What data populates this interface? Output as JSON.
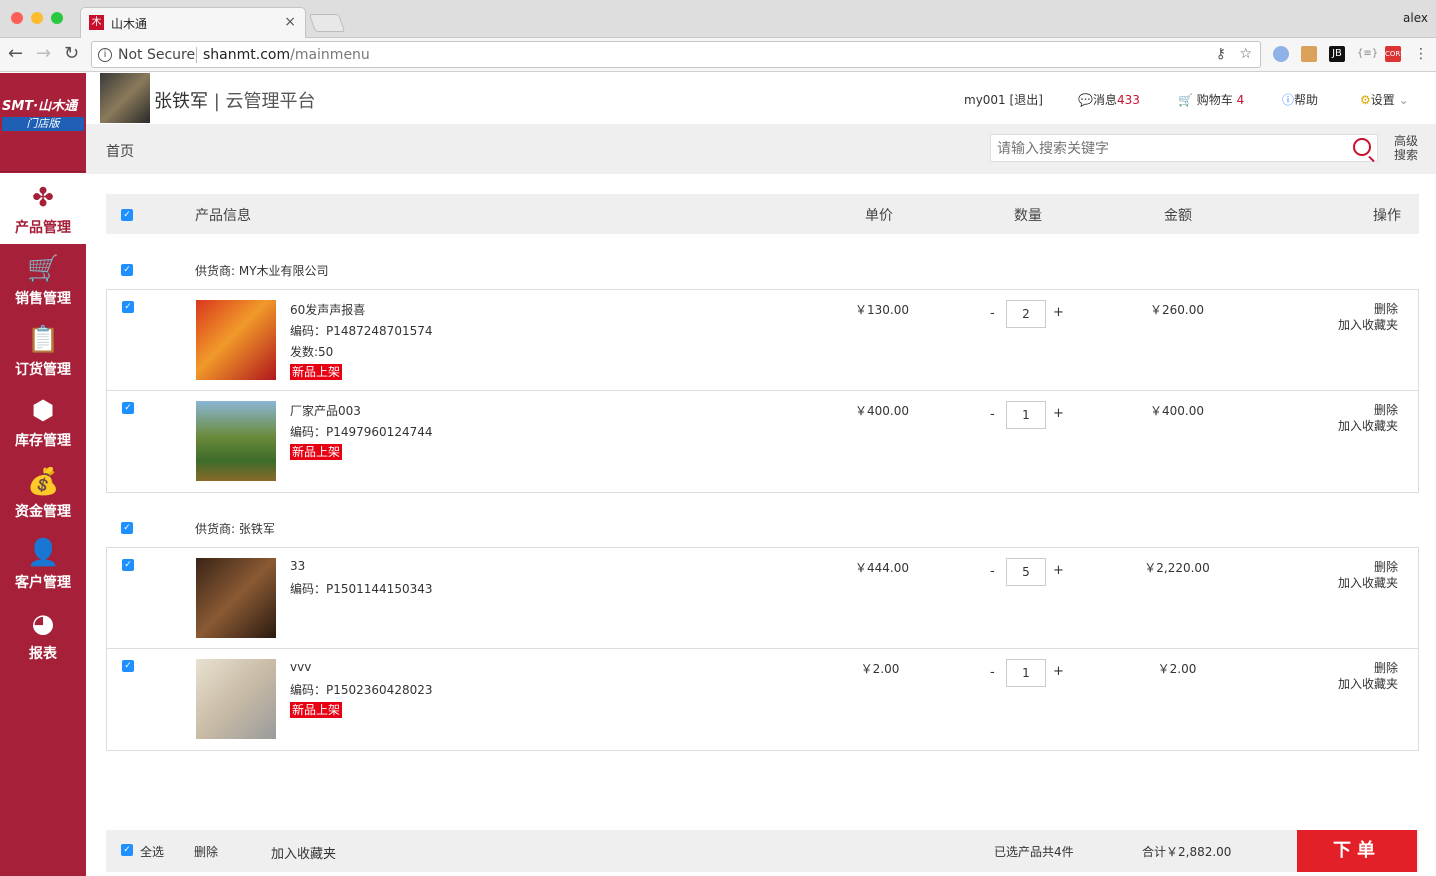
{
  "browser": {
    "tab_title": "山木通",
    "tab_favicon": "木",
    "profile": "alex",
    "security": "Not Secure",
    "url_host": "shanmt.com",
    "url_path": "/mainmenu"
  },
  "logo": {
    "text": "SMT·山木通",
    "badge": "门店版"
  },
  "sidebar": {
    "items": [
      {
        "label": "产品管理",
        "icon": "product-icon",
        "glyph": "✤",
        "active": true
      },
      {
        "label": "销售管理",
        "icon": "cart-icon",
        "glyph": "🛒",
        "active": false
      },
      {
        "label": "订货管理",
        "icon": "clipboard-icon",
        "glyph": "📋",
        "active": false
      },
      {
        "label": "库存管理",
        "icon": "boxes-icon",
        "glyph": "⬢",
        "active": false
      },
      {
        "label": "资金管理",
        "icon": "money-bag-icon",
        "glyph": "💰",
        "active": false
      },
      {
        "label": "客户管理",
        "icon": "user-icon",
        "glyph": "👤",
        "active": false
      },
      {
        "label": "报表",
        "icon": "pie-chart-icon",
        "glyph": "◕",
        "active": false
      }
    ]
  },
  "header": {
    "shop_owner": "张铁军",
    "separator": "|",
    "platform": "云管理平台",
    "user": "my001",
    "logout": "[退出]",
    "messages_label": "消息",
    "messages_count": "433",
    "cart_label": "购物车",
    "cart_count": "4",
    "help": "帮助",
    "settings": "设置"
  },
  "breadcrumb": "首页",
  "search": {
    "placeholder": "请输入搜索关键字",
    "advanced": "高级搜索"
  },
  "table": {
    "headers": {
      "product": "产品信息",
      "price": "单价",
      "qty": "数量",
      "amount": "金额",
      "ops": "操作"
    }
  },
  "groups": [
    {
      "supplier": "供货商: MY木业有限公司",
      "rows": [
        {
          "name": "60发声声报喜",
          "code": "编码：P1487248701574",
          "extra": "发数:50",
          "tag": "新品上架",
          "price": "￥130.00",
          "qty": "2",
          "amount": "￥260.00"
        },
        {
          "name": "厂家产品003",
          "code": "编码：P1497960124744",
          "extra": "",
          "tag": "新品上架",
          "price": "￥400.00",
          "qty": "1",
          "amount": "￥400.00"
        }
      ]
    },
    {
      "supplier": "供货商: 张铁军",
      "rows": [
        {
          "name": "33",
          "code": "编码：P1501144150343",
          "extra": "",
          "tag": "",
          "price": "￥444.00",
          "qty": "5",
          "amount": "￥2,220.00"
        },
        {
          "name": "vvv",
          "code": "编码：P1502360428023",
          "extra": "",
          "tag": "新品上架",
          "price": "￥2.00",
          "qty": "1",
          "amount": "￥2.00"
        }
      ]
    }
  ],
  "ops": {
    "delete": "删除",
    "favorite": "加入收藏夹",
    "minus": "-",
    "plus": "+"
  },
  "footer": {
    "select_all": "全选",
    "delete": "删除",
    "favorite": "加入收藏夹",
    "selected": "已选产品共4件",
    "total": "合计￥2,882.00",
    "order": "下单"
  }
}
